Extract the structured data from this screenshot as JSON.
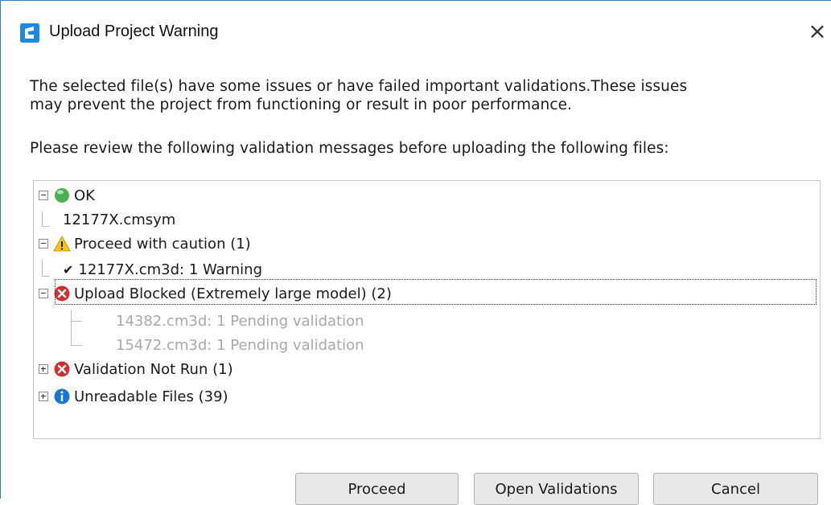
{
  "window": {
    "title": "Upload Project Warning",
    "close_label": "×"
  },
  "message": {
    "line1": "The selected file(s) have some issues or have failed important validations.These issues",
    "line2": "may prevent the project from functioning or result in poor performance.",
    "line3": "Please review the following validation messages before uploading the following files:"
  },
  "tree": {
    "groups": [
      {
        "label": "OK",
        "icon": "green-circle-icon",
        "expanded": true,
        "children": [
          {
            "label": "12177X.cmsym"
          }
        ]
      },
      {
        "label": "Proceed with caution (1)",
        "icon": "warning-triangle-icon",
        "expanded": true,
        "children": [
          {
            "label": "12177X.cm3d: 1 Warning",
            "check": "✔"
          }
        ]
      },
      {
        "label": "Upload Blocked (Extremely large model) (2)",
        "icon": "red-x-icon",
        "expanded": true,
        "selected": true,
        "children": [
          {
            "label": "14382.cm3d: 1 Pending validation"
          },
          {
            "label": "15472.cm3d: 1 Pending validation"
          }
        ]
      },
      {
        "label": "Validation Not Run (1)",
        "icon": "red-x-icon",
        "expanded": false
      },
      {
        "label": "Unreadable Files (39)",
        "icon": "info-icon",
        "expanded": false
      }
    ]
  },
  "buttons": {
    "proceed": "Proceed",
    "open_validations": "Open Validations",
    "cancel": "Cancel"
  },
  "colors": {
    "accent": "#2d7dd2",
    "ok_green": "#4caf50",
    "warning_yellow": "#f5c518",
    "error_red": "#d32f2f",
    "info_blue": "#1976d2"
  }
}
